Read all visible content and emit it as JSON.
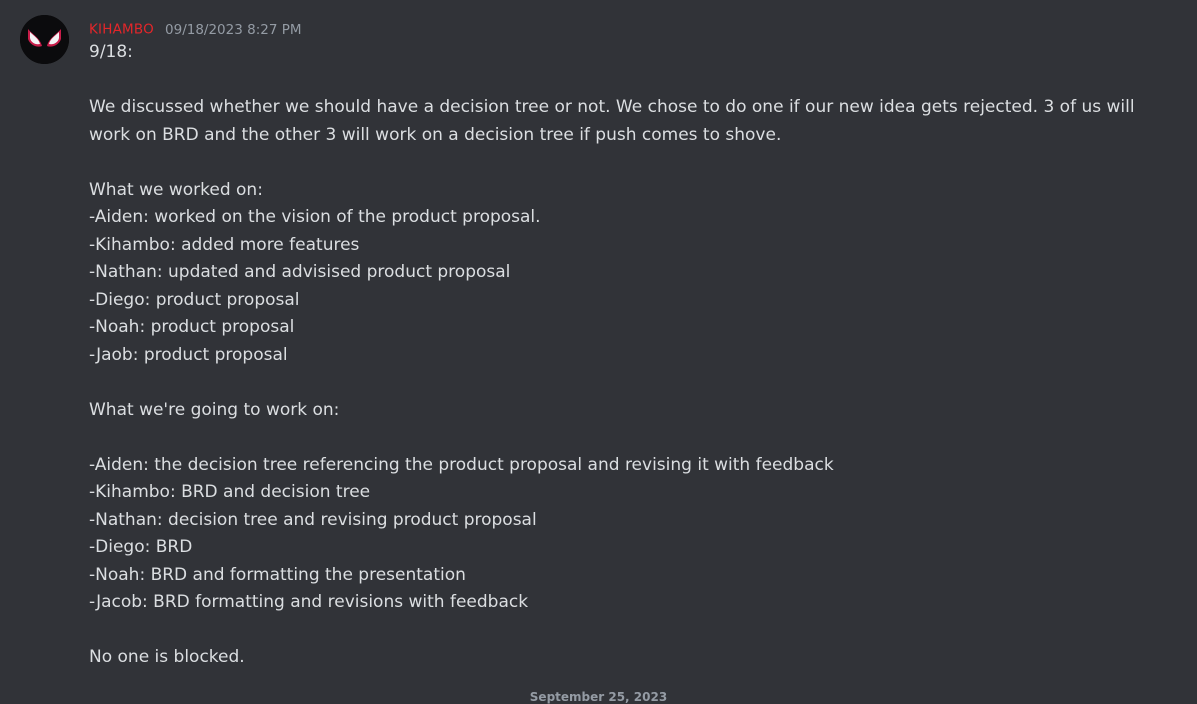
{
  "message": {
    "author": "KIHAMBO",
    "timestamp": "09/18/2023 8:27 PM",
    "avatar_icon": "spider-mask-icon",
    "lines": [
      "9/18:",
      "",
      "We discussed whether we should have a decision tree or not. We chose to do one if our new idea gets rejected. 3 of us will work on BRD and the other 3 will work on a decision tree if push comes to shove.",
      "",
      "What we worked on:",
      "-Aiden: worked on the vision of the product proposal.",
      "-Kihambo: added more features",
      "-Nathan: updated and advisised product proposal",
      "-Diego: product proposal",
      "-Noah: product proposal",
      "-Jaob: product proposal",
      "",
      "What we're going to work on:",
      "",
      "-Aiden: the decision tree referencing the product proposal and revising it with feedback",
      "-Kihambo: BRD and decision tree",
      "-Nathan: decision tree and revising product proposal",
      "-Diego: BRD",
      "-Noah: BRD and formatting the presentation",
      "-Jacob: BRD formatting and revisions with feedback",
      "",
      "No one is blocked."
    ]
  },
  "date_divider": "September 25, 2023",
  "colors": {
    "background": "#313338",
    "author": "#e3262a",
    "text": "#dbdee1",
    "muted": "#949ba4"
  }
}
